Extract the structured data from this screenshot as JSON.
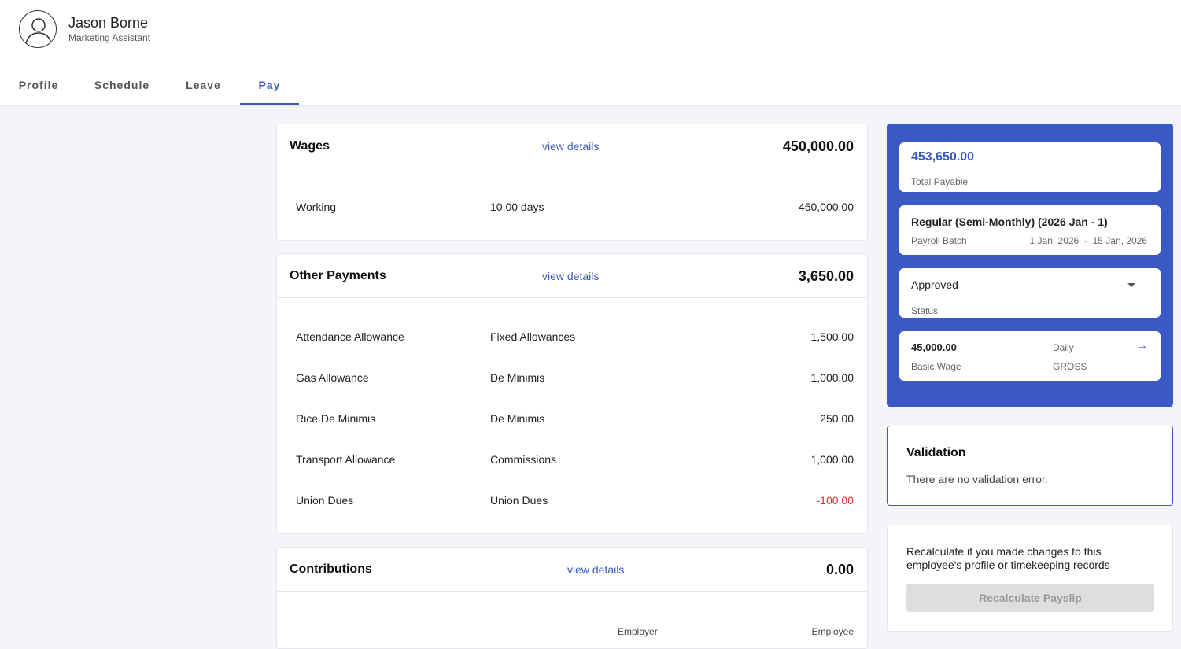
{
  "employee": {
    "name": "Jason Borne",
    "title": "Marketing Assistant"
  },
  "tabs": [
    {
      "label": "Profile",
      "active": false
    },
    {
      "label": "Schedule",
      "active": false
    },
    {
      "label": "Leave",
      "active": false
    },
    {
      "label": "Pay",
      "active": true
    }
  ],
  "wages": {
    "title": "Wages",
    "link": "view details",
    "total": "450,000.00",
    "rows": [
      {
        "name": "Working",
        "type": "10.00 days",
        "amount": "450,000.00"
      }
    ]
  },
  "other_payments": {
    "title": "Other Payments",
    "link": "view details",
    "total": "3,650.00",
    "rows": [
      {
        "name": "Attendance Allowance",
        "type": "Fixed Allowances",
        "amount": "1,500.00"
      },
      {
        "name": "Gas Allowance",
        "type": "De Minimis",
        "amount": "1,000.00"
      },
      {
        "name": "Rice De Minimis",
        "type": "De Minimis",
        "amount": "250.00"
      },
      {
        "name": "Transport Allowance",
        "type": "Commissions",
        "amount": "1,000.00"
      },
      {
        "name": "Union Dues",
        "type": "Union Dues",
        "amount": "-100.00"
      }
    ]
  },
  "contributions": {
    "title": "Contributions",
    "link": "view details",
    "total": "0.00",
    "col_employer": "Employer",
    "col_employee": "Employee"
  },
  "summary": {
    "total_payable": "453,650.00",
    "total_payable_label": "Total Payable",
    "batch_name": "Regular (Semi-Monthly) (2026 Jan - 1)",
    "batch_label": "Payroll Batch",
    "batch_start": "1 Jan, 2026",
    "batch_sep": "-",
    "batch_end": "15 Jan, 2026",
    "status": "Approved",
    "status_label": "Status",
    "basic_wage": "45,000.00",
    "basic_wage_label": "Basic Wage",
    "wage_frequency": "Daily",
    "wage_basis": "GROSS",
    "accent_color": "#3a59c4"
  },
  "validation": {
    "title": "Validation",
    "message": "There are no validation error."
  },
  "recalc": {
    "message": "Recalculate if you made changes to this employee's profile or timekeeping records",
    "button": "Recalculate Payslip"
  }
}
